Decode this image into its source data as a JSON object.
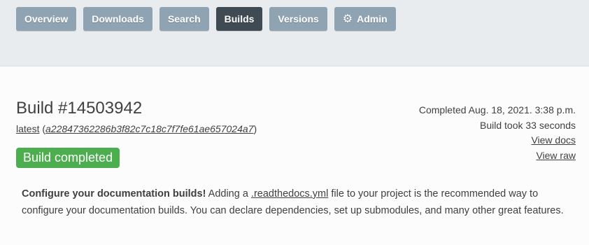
{
  "nav": {
    "overview": "Overview",
    "downloads": "Downloads",
    "search": "Search",
    "builds": "Builds",
    "versions": "Versions",
    "admin": "Admin"
  },
  "build": {
    "title": "Build #14503942",
    "version": "latest",
    "commit": "a22847362286b3f82c7c18c7f7fe61ae657024a7",
    "status": "Build completed"
  },
  "meta": {
    "completed": "Completed Aug. 18, 2021. 3:38 p.m.",
    "duration": "Build took 33 seconds",
    "view_docs": "View docs",
    "view_raw": "View raw"
  },
  "notice": {
    "strong": "Configure your documentation builds!",
    "before_link": " Adding a ",
    "link": ".readthedocs.yml",
    "after_link": " file to your project is the recommended way to configure your documentation builds. You can declare dependencies, set up submodules, and many other great features."
  },
  "colors": {
    "nav_button": "#8fa3b2",
    "nav_active": "#3f4a52",
    "success": "#4cae4f",
    "header_bg": "#e8ecef"
  },
  "icons": {
    "admin": "gear-icon"
  }
}
